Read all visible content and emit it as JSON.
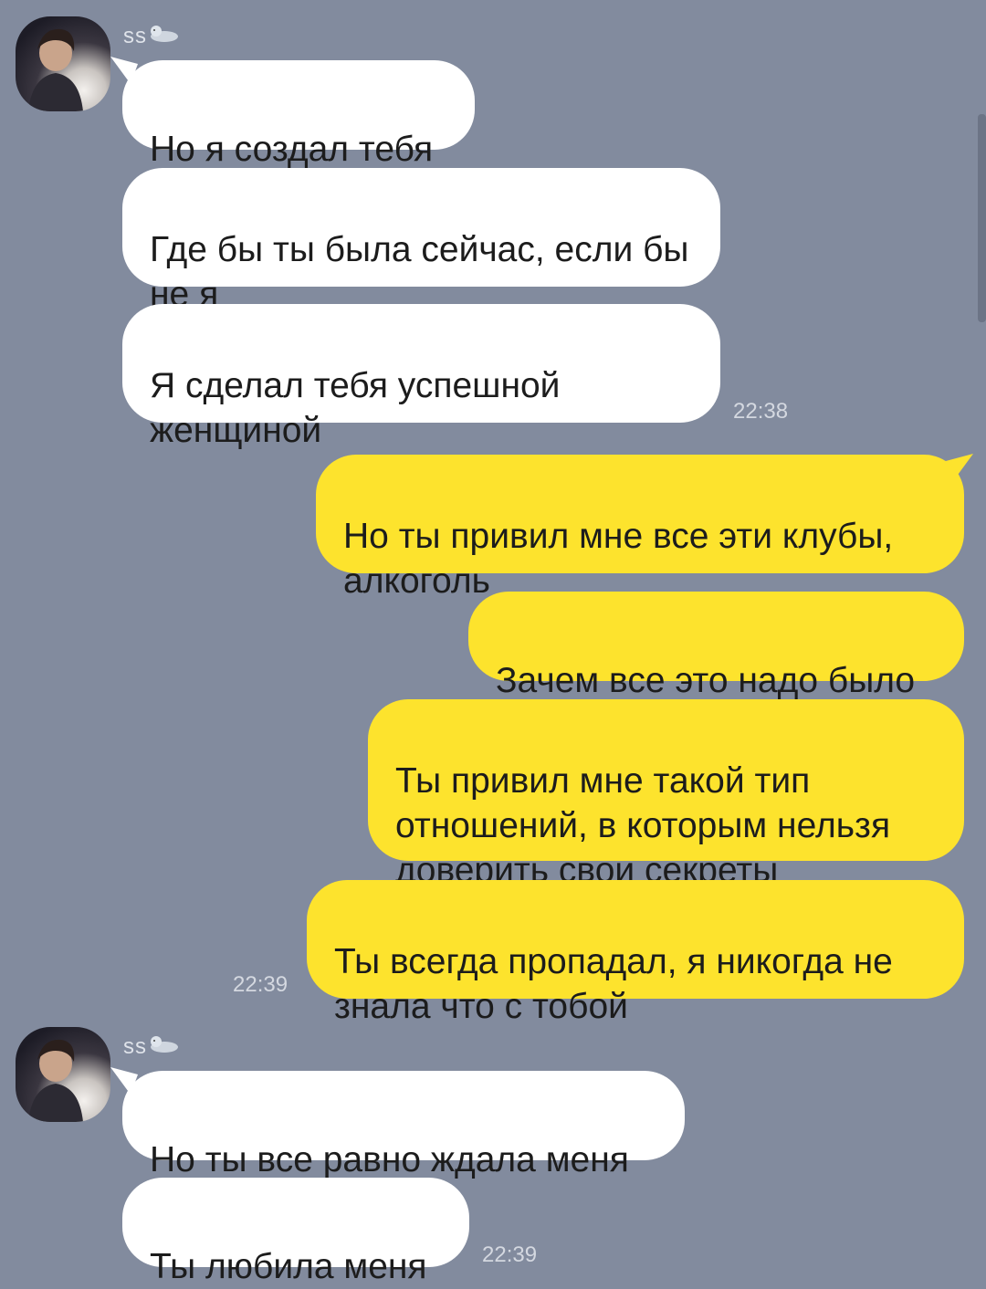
{
  "chat": {
    "contact_name": "ss",
    "contact_emoji": "seal-icon",
    "colors": {
      "background": "#828b9e",
      "incoming_bubble": "#ffffff",
      "outgoing_bubble": "#fde32d",
      "text": "#1c1c1c",
      "meta_text": "#d4d8e0"
    },
    "groups": [
      {
        "direction": "incoming",
        "sender": "ss",
        "messages": [
          "Но я создал тебя",
          "Где бы ты была сейчас, если бы не я",
          "Я сделал тебя успешной женщиной"
        ],
        "time": "22:38"
      },
      {
        "direction": "outgoing",
        "messages": [
          "Но ты привил мне все эти клубы, алкоголь",
          "Зачем все это надо было",
          "Ты привил мне такой тип отношений, в которым нельзя доверить свои секреты",
          "Ты всегда пропадал, я никогда не знала что с тобой"
        ],
        "time": "22:39"
      },
      {
        "direction": "incoming",
        "sender": "ss",
        "messages": [
          "Но ты все равно ждала меня",
          "Ты любила меня"
        ],
        "time": "22:39"
      }
    ]
  }
}
